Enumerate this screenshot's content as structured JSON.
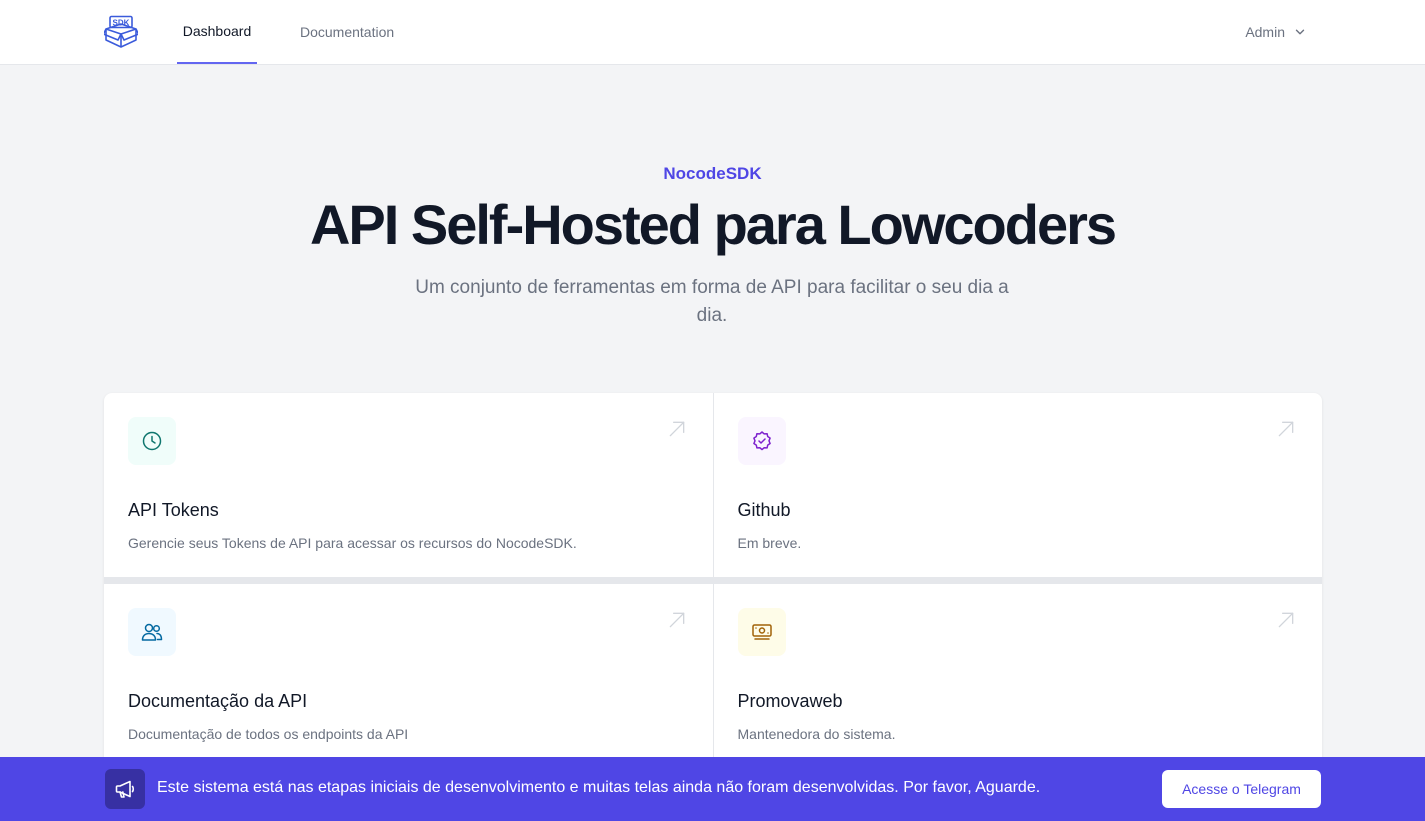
{
  "nav": {
    "logo_text": "SDK",
    "links": [
      {
        "label": "Dashboard",
        "active": true
      },
      {
        "label": "Documentation",
        "active": false
      }
    ],
    "user": {
      "label": "Admin"
    }
  },
  "hero": {
    "eyebrow": "NocodeSDK",
    "title": "API Self-Hosted para Lowcoders",
    "subtitle": "Um conjunto de ferramentas em forma de API para facilitar o seu dia a dia."
  },
  "cards": [
    {
      "title": "API Tokens",
      "description": "Gerencie seus Tokens de API para acessar os recursos do NocodeSDK.",
      "icon": "clock-icon",
      "color": "#0f766e"
    },
    {
      "title": "Github",
      "description": "Em breve.",
      "icon": "badge-check-icon",
      "color": "#7e22ce"
    },
    {
      "title": "Documentação da API",
      "description": "Documentação de todos os endpoints da API",
      "icon": "users-icon",
      "color": "#0369a1"
    },
    {
      "title": "Promovaweb",
      "description": "Mantenedora do sistema.",
      "icon": "cash-icon",
      "color": "#a16207"
    }
  ],
  "banner": {
    "text": "Este sistema está nas etapas iniciais de desenvolvimento e muitas telas ainda não foram desenvolvidas. Por favor, Aguarde.",
    "button_label": "Acesse o Telegram",
    "icon": "megaphone-icon",
    "color": "#4f46e5"
  }
}
